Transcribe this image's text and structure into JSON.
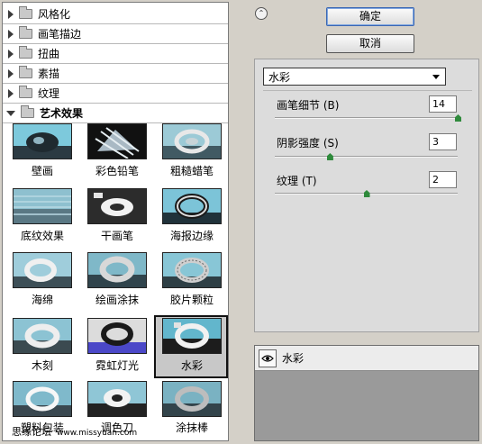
{
  "gallery": {
    "categories": [
      {
        "label": "风格化",
        "open": false
      },
      {
        "label": "画笔描边",
        "open": false
      },
      {
        "label": "扭曲",
        "open": false
      },
      {
        "label": "素描",
        "open": false
      },
      {
        "label": "纹理",
        "open": false
      },
      {
        "label": "艺术效果",
        "open": true
      }
    ],
    "filters": [
      {
        "label": "壁画",
        "icon": "fresco-thumbnail"
      },
      {
        "label": "彩色铅笔",
        "icon": "colored-pencil-thumbnail"
      },
      {
        "label": "粗糙蜡笔",
        "icon": "rough-pastels-thumbnail"
      },
      {
        "label": "底纹效果",
        "icon": "underpainting-thumbnail"
      },
      {
        "label": "干画笔",
        "icon": "dry-brush-thumbnail"
      },
      {
        "label": "海报边缘",
        "icon": "poster-edges-thumbnail"
      },
      {
        "label": "海绵",
        "icon": "sponge-thumbnail"
      },
      {
        "label": "绘画涂抹",
        "icon": "paint-daubs-thumbnail"
      },
      {
        "label": "胶片颗粒",
        "icon": "film-grain-thumbnail"
      },
      {
        "label": "木刻",
        "icon": "cutout-thumbnail"
      },
      {
        "label": "霓虹灯光",
        "icon": "neon-glow-thumbnail"
      },
      {
        "label": "水彩",
        "icon": "watercolor-thumbnail",
        "selected": true
      },
      {
        "label": "塑料包装",
        "icon": "plastic-wrap-thumbnail"
      },
      {
        "label": "调色刀",
        "icon": "palette-knife-thumbnail"
      },
      {
        "label": "涂抹棒",
        "icon": "smudge-stick-thumbnail"
      }
    ],
    "watermark": "思缘论坛",
    "watermark_site": "www.missyuan.com"
  },
  "buttons": {
    "ok": "确定",
    "cancel": "取消"
  },
  "filter_select": {
    "value": "水彩"
  },
  "params": [
    {
      "label": "画笔细节 (B)",
      "value": "14",
      "level": 1.0
    },
    {
      "label": "阴影强度 (S)",
      "value": "3",
      "level": 0.3
    },
    {
      "label": "纹理 (T)",
      "value": "2",
      "level": 0.5
    }
  ],
  "layers": [
    {
      "name": "水彩",
      "icon": "eye-icon"
    }
  ],
  "colors": {
    "panel_bg": "#d4d0c8",
    "slider_knob": "#2f8a3c",
    "default_button_border": "#3a67b3"
  }
}
